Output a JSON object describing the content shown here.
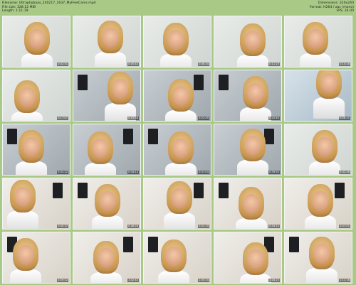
{
  "header": {
    "filename_label": "Filename:",
    "filename": "Ultraphybaas_240217_1637_MyFreeCams.mp4",
    "filesize_label": "File size:",
    "filesize": "328.12 MiB",
    "length_label": "Length:",
    "length": "1:11:19",
    "dimensions_label": "Dimensions:",
    "dimensions": "320x240",
    "format_label": "Format:",
    "format": "H264 / aac (mono)",
    "fps_label": "FPS:",
    "fps": "24.00"
  },
  "thumbnails": [
    {
      "time": "0:02:51",
      "variant": "v1"
    },
    {
      "time": "0:05:43",
      "variant": "v1"
    },
    {
      "time": "0:08:34",
      "variant": "v1"
    },
    {
      "time": "0:11:25",
      "variant": "v1"
    },
    {
      "time": "0:14:16",
      "variant": "v1"
    },
    {
      "time": "0:17:07",
      "variant": "v1"
    },
    {
      "time": "0:19:58",
      "variant": "v2"
    },
    {
      "time": "0:22:49",
      "variant": "v2"
    },
    {
      "time": "0:25:40",
      "variant": "v2"
    },
    {
      "time": "0:28:31",
      "variant": "v4"
    },
    {
      "time": "0:31:22",
      "variant": "v2"
    },
    {
      "time": "0:34:13",
      "variant": "v2"
    },
    {
      "time": "0:37:04",
      "variant": "v2"
    },
    {
      "time": "0:39:55",
      "variant": "v2"
    },
    {
      "time": "0:42:46",
      "variant": "v1"
    },
    {
      "time": "0:45:37",
      "variant": "v3"
    },
    {
      "time": "0:48:28",
      "variant": "v3"
    },
    {
      "time": "0:51:19",
      "variant": "v3"
    },
    {
      "time": "0:54:10",
      "variant": "v3"
    },
    {
      "time": "0:57:01",
      "variant": "v3"
    },
    {
      "time": "0:59:52",
      "variant": "v3"
    },
    {
      "time": "1:02:43",
      "variant": "v3"
    },
    {
      "time": "1:05:34",
      "variant": "v3"
    },
    {
      "time": "1:08:25",
      "variant": "v3"
    },
    {
      "time": "1:11:16",
      "variant": "v3"
    }
  ]
}
